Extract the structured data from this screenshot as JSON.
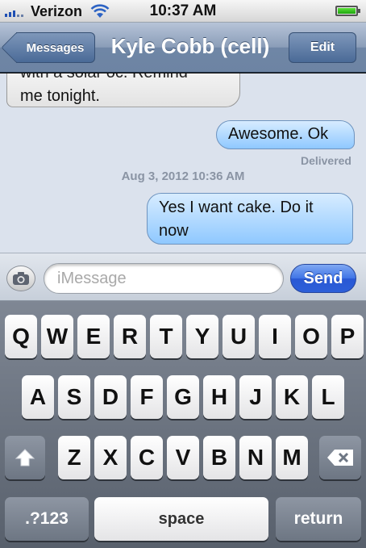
{
  "status_bar": {
    "carrier": "Verizon",
    "time": "10:37 AM",
    "battery_level": 1.0
  },
  "nav": {
    "back_label": "Messages",
    "title": "Kyle Cobb (cell)",
    "edit_label": "Edit"
  },
  "conversation": {
    "incoming_partial_line": "with a solar oc.  Remind",
    "incoming_line": "me tonight.",
    "outgoing_1": "Awesome. Ok",
    "delivered": "Delivered",
    "timestamp": "Aug 3, 2012 10:36 AM",
    "outgoing_2": "Yes I want cake. Do it now"
  },
  "input_bar": {
    "placeholder": "iMessage",
    "value": "",
    "send_label": "Send"
  },
  "keyboard": {
    "row1": [
      "Q",
      "W",
      "E",
      "R",
      "T",
      "Y",
      "U",
      "I",
      "O",
      "P"
    ],
    "row2": [
      "A",
      "S",
      "D",
      "F",
      "G",
      "H",
      "J",
      "K",
      "L"
    ],
    "row3": [
      "Z",
      "X",
      "C",
      "V",
      "B",
      "N",
      "M"
    ],
    "numbers_label": ".?123",
    "space_label": "space",
    "return_label": "return"
  },
  "icons": {
    "shift": "shift-arrow-icon",
    "delete": "backspace-icon",
    "camera": "camera-icon",
    "wifi": "wifi-icon",
    "signal": "signal-bars-icon",
    "battery": "battery-icon"
  }
}
